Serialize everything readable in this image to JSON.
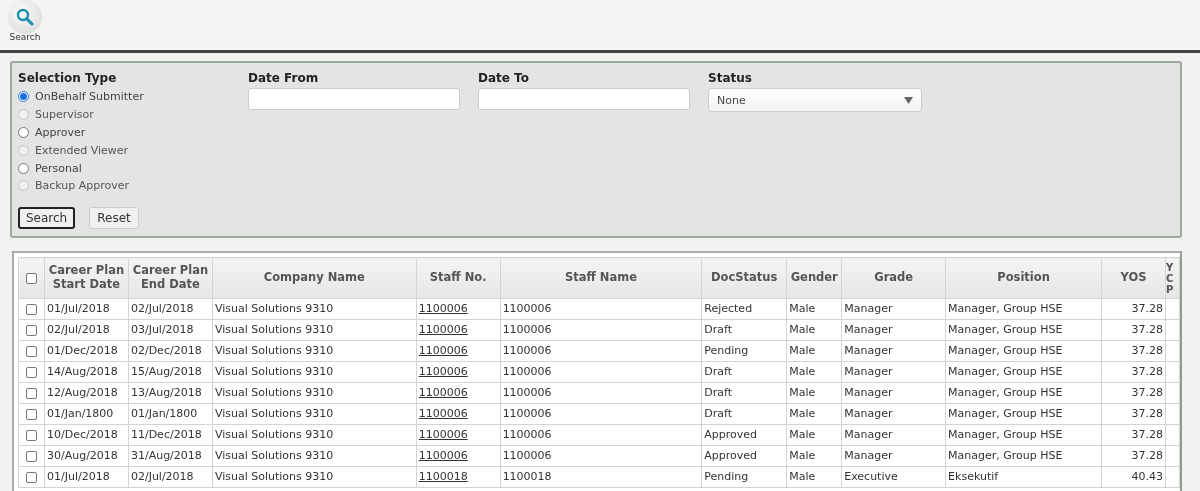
{
  "toolbar": {
    "search_button": {
      "label": "Search"
    }
  },
  "filter": {
    "selection_type": {
      "label": "Selection Type",
      "options": [
        {
          "label": "OnBehalf Submitter",
          "selected": true,
          "disabled": false
        },
        {
          "label": "Supervisor",
          "selected": false,
          "disabled": true
        },
        {
          "label": "Approver",
          "selected": false,
          "disabled": false
        },
        {
          "label": "Extended Viewer",
          "selected": false,
          "disabled": true
        },
        {
          "label": "Personal",
          "selected": false,
          "disabled": false
        },
        {
          "label": "Backup Approver",
          "selected": false,
          "disabled": true
        }
      ]
    },
    "date_from": {
      "label": "Date From"
    },
    "date_to": {
      "label": "Date To"
    },
    "status": {
      "label": "Status",
      "value": "None"
    },
    "buttons": [
      {
        "label": "Search",
        "kind": "primary"
      },
      {
        "label": "Reset",
        "kind": "secondary"
      }
    ]
  },
  "table": {
    "all_checked": false,
    "columns": [
      {
        "label": "Career Plan Start Date"
      },
      {
        "label": "Career Plan End Date"
      },
      {
        "label": "Company Name"
      },
      {
        "label": "Staff No."
      },
      {
        "label": "Staff Name"
      },
      {
        "label": "DocStatus"
      },
      {
        "label": "Gender"
      },
      {
        "label": "Grade"
      },
      {
        "label": "Position"
      },
      {
        "label": "YOS"
      },
      {
        "label": "Y C P",
        "kind": "cut"
      }
    ],
    "rows": [
      {
        "checked": false,
        "cells": [
          "01/Jul/2018",
          "02/Jul/2018",
          "Visual Solutions 9310",
          "1100006",
          "1100006",
          "Rejected",
          "Male",
          "Manager",
          "Manager, Group HSE",
          "37.28"
        ]
      },
      {
        "checked": false,
        "cells": [
          "02/Jul/2018",
          "03/Jul/2018",
          "Visual Solutions 9310",
          "1100006",
          "1100006",
          "Draft",
          "Male",
          "Manager",
          "Manager, Group HSE",
          "37.28"
        ]
      },
      {
        "checked": false,
        "cells": [
          "01/Dec/2018",
          "02/Dec/2018",
          "Visual Solutions 9310",
          "1100006",
          "1100006",
          "Pending",
          "Male",
          "Manager",
          "Manager, Group HSE",
          "37.28"
        ]
      },
      {
        "checked": false,
        "cells": [
          "14/Aug/2018",
          "15/Aug/2018",
          "Visual Solutions 9310",
          "1100006",
          "1100006",
          "Draft",
          "Male",
          "Manager",
          "Manager, Group HSE",
          "37.28"
        ]
      },
      {
        "checked": false,
        "cells": [
          "12/Aug/2018",
          "13/Aug/2018",
          "Visual Solutions 9310",
          "1100006",
          "1100006",
          "Draft",
          "Male",
          "Manager",
          "Manager, Group HSE",
          "37.28"
        ]
      },
      {
        "checked": false,
        "cells": [
          "01/Jan/1800",
          "01/Jan/1800",
          "Visual Solutions 9310",
          "1100006",
          "1100006",
          "Draft",
          "Male",
          "Manager",
          "Manager, Group HSE",
          "37.28"
        ]
      },
      {
        "checked": false,
        "cells": [
          "10/Dec/2018",
          "11/Dec/2018",
          "Visual Solutions 9310",
          "1100006",
          "1100006",
          "Approved",
          "Male",
          "Manager",
          "Manager, Group HSE",
          "37.28"
        ]
      },
      {
        "checked": false,
        "cells": [
          "30/Aug/2018",
          "31/Aug/2018",
          "Visual Solutions 9310",
          "1100006",
          "1100006",
          "Approved",
          "Male",
          "Manager",
          "Manager, Group HSE",
          "37.28"
        ]
      },
      {
        "checked": false,
        "cells": [
          "01/Jul/2018",
          "02/Jul/2018",
          "Visual Solutions 9310",
          "1100018",
          "1100018",
          "Pending",
          "Male",
          "Executive",
          "Eksekutif",
          "40.43"
        ]
      }
    ]
  }
}
